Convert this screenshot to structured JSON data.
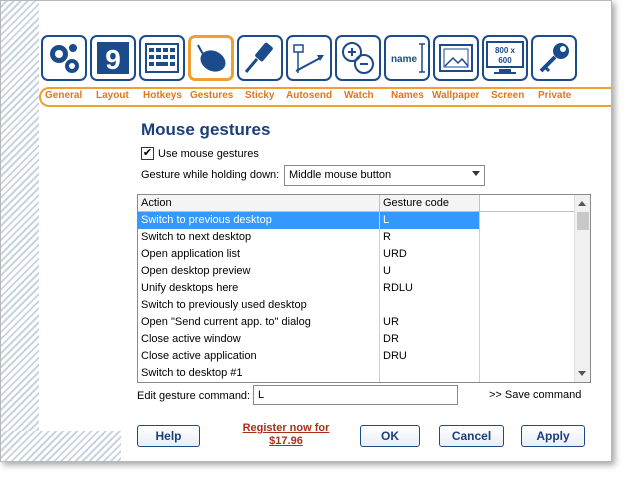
{
  "toolbar": {
    "icons": [
      {
        "name": "General",
        "icon": "gears-icon"
      },
      {
        "name": "Layout",
        "icon": "layout-icon"
      },
      {
        "name": "Hotkeys",
        "icon": "keyboard-icon"
      },
      {
        "name": "Gestures",
        "icon": "mouse-icon"
      },
      {
        "name": "Sticky",
        "icon": "pin-icon"
      },
      {
        "name": "Autosend",
        "icon": "send-arrow-icon"
      },
      {
        "name": "Watch",
        "icon": "zoom-plus-minus-icon"
      },
      {
        "name": "Names",
        "icon": "name-tag-icon",
        "text": "name"
      },
      {
        "name": "Wallpaper",
        "icon": "wallpaper-icon"
      },
      {
        "name": "Screen",
        "icon": "monitor-icon",
        "text1": "800 x",
        "text2": "600"
      },
      {
        "name": "Private",
        "icon": "key-icon"
      }
    ],
    "active": "Gestures",
    "accent": "#f0a030",
    "border_color": "#1b4b8a"
  },
  "page": {
    "title": "Mouse gestures",
    "use_gestures_label": "Use mouse gestures",
    "use_gestures_checked": true,
    "holding_label": "Gesture while holding down:",
    "holding_value": "Middle mouse button"
  },
  "list": {
    "headers": {
      "action": "Action",
      "code": "Gesture code"
    },
    "rows": [
      {
        "action": "Switch to previous desktop",
        "code": "L",
        "selected": true
      },
      {
        "action": "Switch to next desktop",
        "code": "R"
      },
      {
        "action": "Open application list",
        "code": "URD"
      },
      {
        "action": "Open desktop preview",
        "code": "U"
      },
      {
        "action": "Unify desktops here",
        "code": "RDLU"
      },
      {
        "action": "Switch to previously used desktop",
        "code": ""
      },
      {
        "action": "Open \"Send current app. to\" dialog",
        "code": "UR"
      },
      {
        "action": "Close active window",
        "code": "DR"
      },
      {
        "action": "Close active application",
        "code": "DRU"
      },
      {
        "action": "Switch to desktop #1",
        "code": ""
      }
    ]
  },
  "edit": {
    "label": "Edit gesture command:",
    "value": "L",
    "save_label": ">> Save command"
  },
  "buttons": {
    "help": "Help",
    "register_line1": "Register now for",
    "register_line2": "$17.96",
    "ok": "OK",
    "cancel": "Cancel",
    "apply": "Apply"
  }
}
